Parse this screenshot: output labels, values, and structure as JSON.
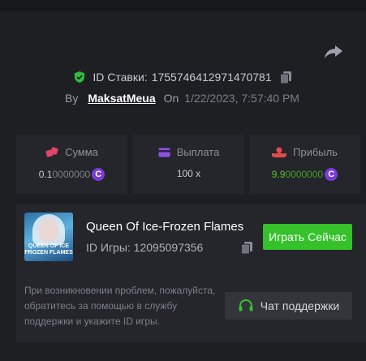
{
  "bet": {
    "id_label": "ID Ставки:",
    "id_value": "1755746412971470781",
    "by_label": "By",
    "username": "MaksatMeua",
    "on_label": "On",
    "date": "1/22/2023, 7:57:40 PM"
  },
  "stats": {
    "amount": {
      "label": "Сумма",
      "value_main": "0.1",
      "value_rest": "0000000",
      "coin": "C"
    },
    "payout": {
      "label": "Выплата",
      "value": "100 x"
    },
    "profit": {
      "label": "Прибыль",
      "value_main": "9.9",
      "value_rest": "0000000",
      "coin": "C"
    }
  },
  "game": {
    "thumb_text_line1": "QUEEN OF ICE",
    "thumb_text_line2": "FROZEN FLAMES",
    "title": "Queen Of Ice-Frozen Flames",
    "id_text": "ID Игры: 12095097356",
    "play_label": "Играть Сейчас",
    "note": "При возникновении проблем, пожалуйста, обратитесь за помощью в службу поддержки и укажите ID игры.",
    "support_label": "Чат поддержки"
  },
  "colors": {
    "background": "#1e1f23",
    "card": "#24262b",
    "accent_green": "#35c12a",
    "profit_green": "#55c72c",
    "coin_purple": "#7b39d9",
    "amount_pink": "#e0456a",
    "payout_purple": "#8f52e8",
    "profit_red": "#e34b4b"
  },
  "icons": [
    "share-icon",
    "shield-check-icon",
    "copy-icon",
    "dice-icon",
    "card-icon",
    "user-profit-icon",
    "coin-icon",
    "headset-icon"
  ]
}
